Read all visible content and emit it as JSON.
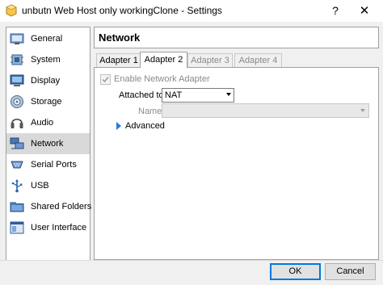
{
  "window": {
    "title": "unbutn Web Host only workingClone - Settings",
    "help_glyph": "?",
    "close_glyph": "✕"
  },
  "sidebar": {
    "items": [
      {
        "label": "General",
        "icon": "general-icon"
      },
      {
        "label": "System",
        "icon": "system-icon"
      },
      {
        "label": "Display",
        "icon": "display-icon"
      },
      {
        "label": "Storage",
        "icon": "storage-icon"
      },
      {
        "label": "Audio",
        "icon": "audio-icon"
      },
      {
        "label": "Network",
        "icon": "network-icon",
        "selected": true
      },
      {
        "label": "Serial Ports",
        "icon": "serial-ports-icon"
      },
      {
        "label": "USB",
        "icon": "usb-icon"
      },
      {
        "label": "Shared Folders",
        "icon": "shared-folders-icon"
      },
      {
        "label": "User Interface",
        "icon": "user-interface-icon"
      }
    ]
  },
  "section": {
    "title": "Network"
  },
  "tabs": [
    {
      "label": "Adapter 1",
      "state": "normal"
    },
    {
      "label": "Adapter 2",
      "state": "active"
    },
    {
      "label": "Adapter 3",
      "state": "disabled"
    },
    {
      "label": "Adapter 4",
      "state": "disabled"
    }
  ],
  "adapter": {
    "enable_label": "Enable Network Adapter",
    "enable_checked": true,
    "attached_label": "Attached to:",
    "attached_value": "NAT",
    "name_label": "Name:",
    "name_value": "",
    "advanced_label": "Advanced"
  },
  "buttons": {
    "ok": "OK",
    "cancel": "Cancel"
  },
  "colors": {
    "selected_bg": "#d9d9d9",
    "accent": "#2a7ae2",
    "default_button_border": "#0078d7"
  }
}
